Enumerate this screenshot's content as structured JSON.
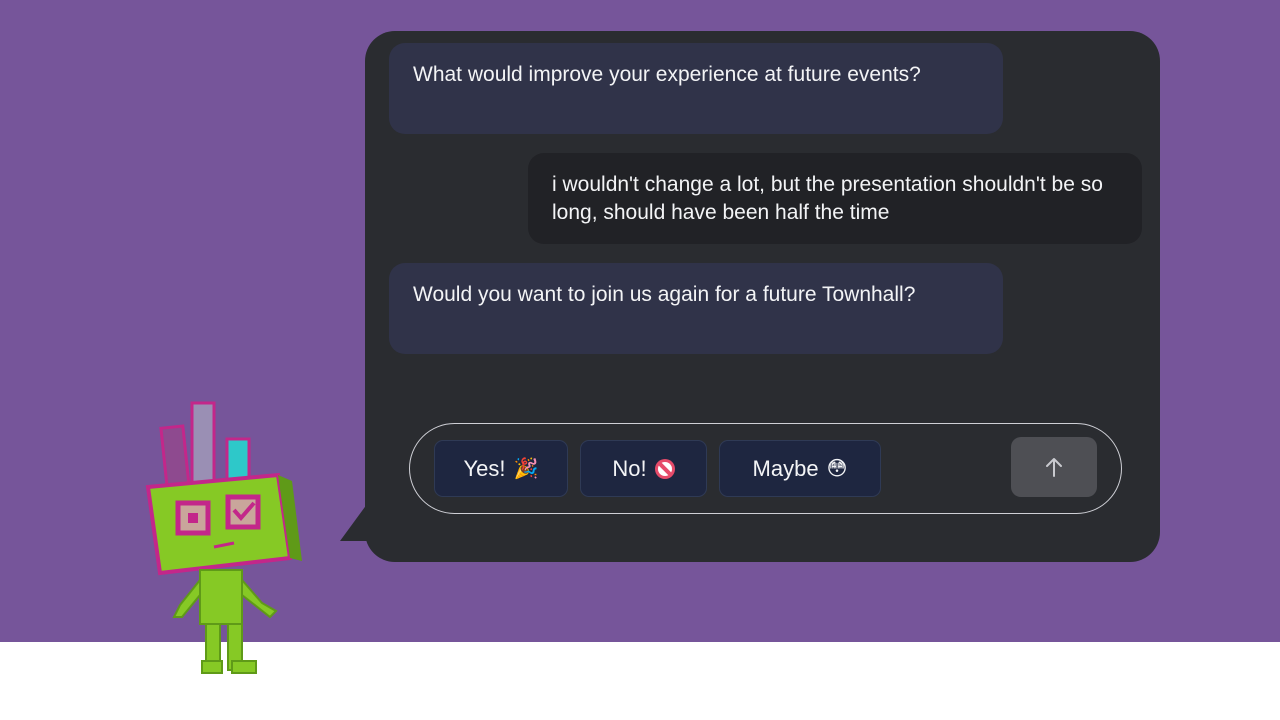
{
  "messages": [
    {
      "sender": "bot",
      "text": "What would improve your experience at future events?"
    },
    {
      "sender": "user",
      "text": "i wouldn't change a lot, but the presentation shouldn't be so long, should have been half the time"
    },
    {
      "sender": "bot",
      "text": "Would you want to join us again for a future Townhall?"
    }
  ],
  "quick_replies": [
    {
      "label": "Yes!",
      "emoji": "🎉"
    },
    {
      "label": "No!",
      "emoji": "🚫"
    },
    {
      "label": "Maybe",
      "emoji": "😳"
    }
  ],
  "send_button": {
    "icon": "arrow-up-icon"
  },
  "colors": {
    "background": "#76559a",
    "panel": "#2a2c30",
    "bot_bubble": "#303349",
    "user_bubble": "#212226",
    "quick_reply": "#1e2640",
    "send_button": "#4e4f54"
  }
}
